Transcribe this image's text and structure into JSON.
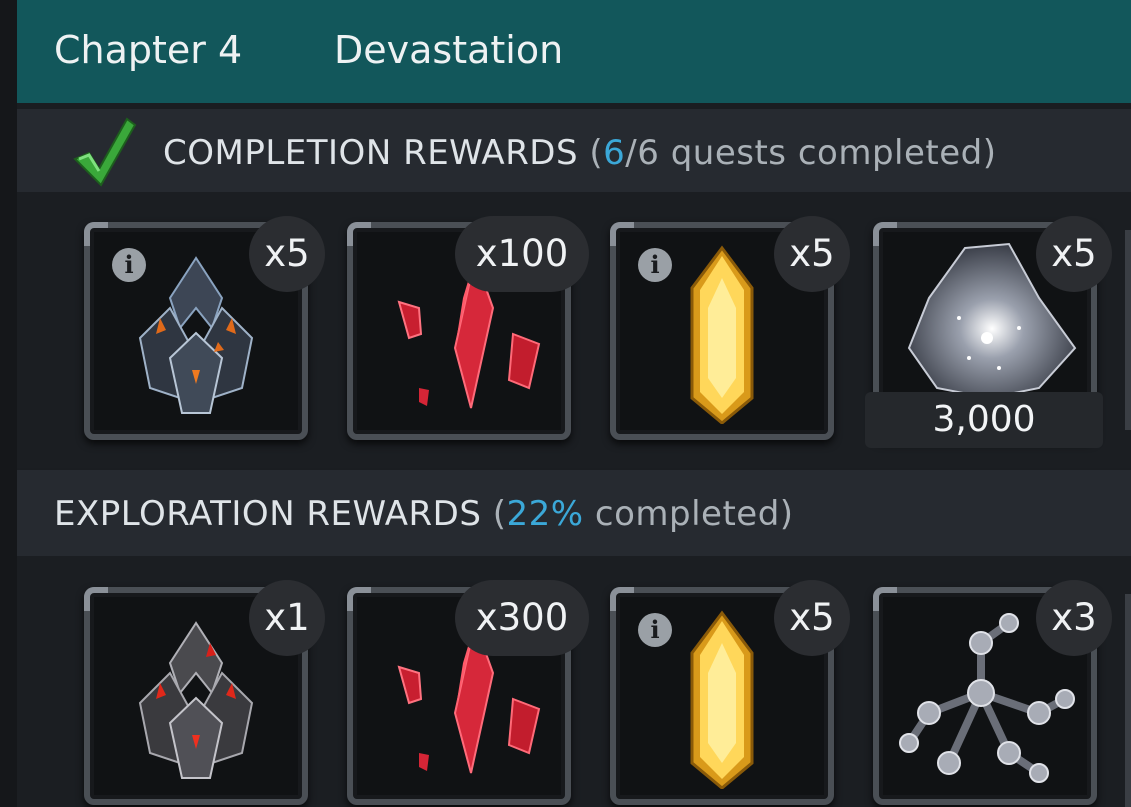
{
  "header": {
    "chapter": "Chapter 4",
    "title": "Devastation"
  },
  "completion": {
    "label": "COMPLETION REWARDS",
    "paren_open": "(",
    "done": "6",
    "slash": "/",
    "total": "6",
    "suffix": " quests completed)",
    "rewards": [
      {
        "qty": "x5",
        "icon": "dark-crystal-cluster-icon",
        "has_info": true
      },
      {
        "qty": "x100",
        "icon": "red-shards-icon",
        "has_info": false
      },
      {
        "qty": "x5",
        "icon": "gold-crystal-icon",
        "has_info": true
      },
      {
        "qty": "x5",
        "icon": "cosmic-stone-icon",
        "has_info": false,
        "amount": "3,000"
      }
    ]
  },
  "exploration": {
    "label": "EXPLORATION REWARDS",
    "paren_open": "(",
    "percent": "22%",
    "suffix": " completed)",
    "rewards": [
      {
        "qty": "x1",
        "icon": "red-dark-crystal-cluster-icon",
        "has_info": false
      },
      {
        "qty": "x300",
        "icon": "red-shards-icon",
        "has_info": false
      },
      {
        "qty": "x5",
        "icon": "gold-crystal-icon",
        "has_info": true
      },
      {
        "qty": "x3",
        "icon": "molecule-catalyst-icon",
        "has_info": false
      }
    ]
  },
  "info_glyph": "i"
}
